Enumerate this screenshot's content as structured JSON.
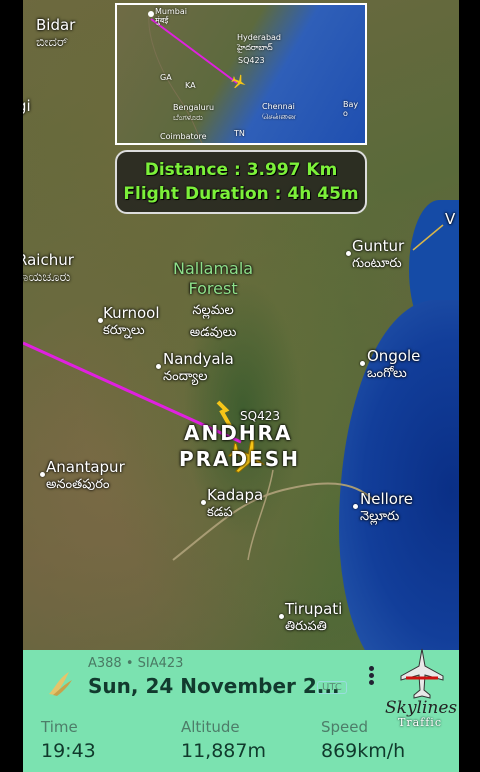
{
  "inset_map": {
    "labels": [
      "Mumbai",
      "मुंबई",
      "Hyderabad",
      "హైదరాబాద్",
      "SQ423",
      "GA",
      "KA",
      "Bengaluru",
      "ಬೆಂಗಳೂರು",
      "Chennai",
      "சென்னை",
      "Bay o",
      "Coimbatore",
      "TN"
    ]
  },
  "info": {
    "distance": "Distance : 3.997 Km",
    "duration": "Flight Duration : 4h 45m"
  },
  "map": {
    "places": {
      "bidar": {
        "name": "Bidar",
        "local": "ಬೀದರ್"
      },
      "raichur": {
        "name": "Raichur",
        "local": "ರಾಯಚೂರು"
      },
      "kurnool": {
        "name": "Kurnool",
        "local": "కర్నూలు"
      },
      "nandyala": {
        "name": "Nandyala",
        "local": "నంద్యాల"
      },
      "anantapur": {
        "name": "Anantapur",
        "local": "అనంతపురం"
      },
      "kadapa": {
        "name": "Kadapa",
        "local": "కడప"
      },
      "tirupati": {
        "name": "Tirupati",
        "local": "తిరుపతి"
      },
      "guntur": {
        "name": "Guntur",
        "local": "గుంటూరు"
      },
      "ongole": {
        "name": "Ongole",
        "local": "ఒంగోలు"
      },
      "nellore": {
        "name": "Nellore",
        "local": "నెల్లూరు"
      }
    },
    "forest": {
      "line1": "Nallamala",
      "line2": "Forest",
      "local1": "నల్లమల",
      "local2": "అడవులు"
    },
    "state": {
      "line1": "ANDHRA",
      "line2": "PRADESH"
    },
    "flight_tag": "SQ423",
    "edge_labels": {
      "gi": "gi",
      "v": "V"
    },
    "colors": {
      "route": "#e020e0",
      "plane": "#f5c518"
    }
  },
  "panel": {
    "flight": "A388 • SIA423",
    "date": "Sun, 24 November 2...",
    "utc": "UTC",
    "time_label": "Time",
    "time_value": "19:43",
    "altitude_label": "Altitude",
    "altitude_value": "11,887m",
    "speed_label": "Speed",
    "speed_value": "869km/h"
  },
  "brand": {
    "name": "Skylines",
    "sub": "Traffic"
  }
}
